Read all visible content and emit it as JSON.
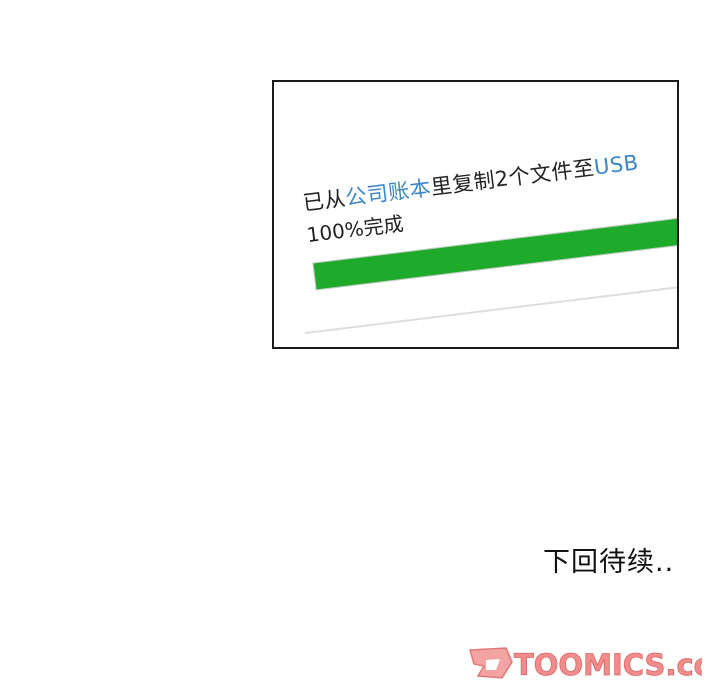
{
  "panel": {
    "message_prefix": "已从",
    "source_link": "公司账本",
    "message_middle": "里复制2个文件至",
    "destination_link": "USB",
    "progress_text": "100%完成",
    "progress_value": 1.0,
    "progress_color": "#1eab2c",
    "link_color": "#3a86c8"
  },
  "footer": {
    "to_be_continued": "下回待续.."
  },
  "watermark": {
    "brand_text": "TOOMICS.com",
    "brand_color": "#f08a8a",
    "icon": "toomics-logo-icon"
  }
}
